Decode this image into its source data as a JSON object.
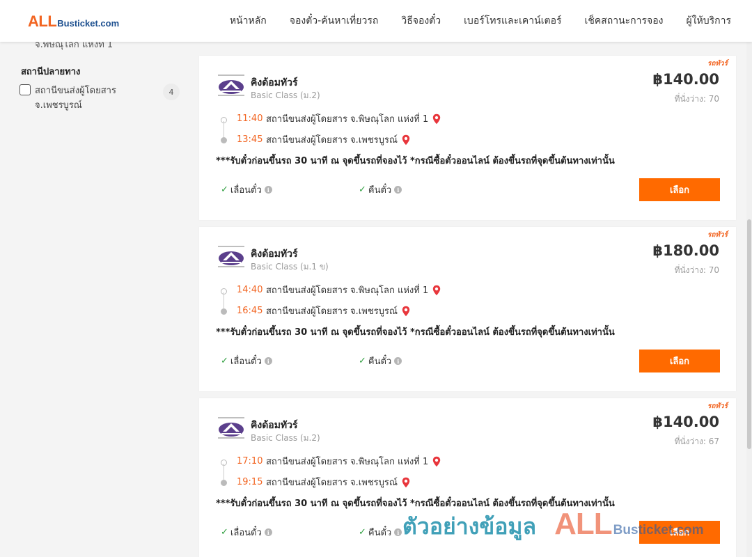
{
  "header": {
    "logo_all": "ALL",
    "logo_rest": "Busticket.com",
    "nav": [
      "หน้าหลัก",
      "จองตั๋ว-ค้นหาเที่ยวรถ",
      "วิธีจองตั๋ว",
      "เบอร์โทรและเคาน์เตอร์",
      "เช็คสถานะการจอง",
      "ผู้ให้บริการ"
    ]
  },
  "sidebar": {
    "prev_item": "จ.พิษณุโลก แห่งที่ 1",
    "dest_title": "สถานีปลายทาง",
    "dest_filter": {
      "label": "สถานีขนส่งผู้โดยสาร จ.เพชรบูรณ์",
      "count": "4",
      "checked": false
    }
  },
  "trips": [
    {
      "tag": "รถทัวร์",
      "operator": "คิงด้อมทัวร์",
      "class": "Basic Class (ม.2)",
      "price": "฿140.00",
      "seats": "ที่นั่งว่าง: 70",
      "depart_time": "11:40",
      "depart_station": "สถานีขนส่งผู้โดยสาร จ.พิษณุโลก แห่งที่ 1",
      "arrive_time": "13:45",
      "arrive_station": "สถานีขนส่งผู้โดยสาร จ.เพชรบูรณ์",
      "note": "***รับตั๋วก่อนขึ้นรถ 30 นาที ณ จุดขึ้นรถที่จองไว้ *กรณีซื้อตั๋วออนไลน์ ต้องขึ้นรถที่จุดขึ้นต้นทางเท่านั้น",
      "feature1": "เลื่อนตั๋ว",
      "feature2": "คืนตั๋ว",
      "button": "เลือก"
    },
    {
      "tag": "รถทัวร์",
      "operator": "คิงด้อมทัวร์",
      "class": "Basic Class (ม.1 ข)",
      "price": "฿180.00",
      "seats": "ที่นั่งว่าง: 70",
      "depart_time": "14:40",
      "depart_station": "สถานีขนส่งผู้โดยสาร จ.พิษณุโลก แห่งที่ 1",
      "arrive_time": "16:45",
      "arrive_station": "สถานีขนส่งผู้โดยสาร จ.เพชรบูรณ์",
      "note": "***รับตั๋วก่อนขึ้นรถ 30 นาที ณ จุดขึ้นรถที่จองไว้ *กรณีซื้อตั๋วออนไลน์ ต้องขึ้นรถที่จุดขึ้นต้นทางเท่านั้น",
      "feature1": "เลื่อนตั๋ว",
      "feature2": "คืนตั๋ว",
      "button": "เลือก"
    },
    {
      "tag": "รถทัวร์",
      "operator": "คิงด้อมทัวร์",
      "class": "Basic Class (ม.2)",
      "price": "฿140.00",
      "seats": "ที่นั่งว่าง: 67",
      "depart_time": "17:10",
      "depart_station": "สถานีขนส่งผู้โดยสาร จ.พิษณุโลก แห่งที่ 1",
      "arrive_time": "19:15",
      "arrive_station": "สถานีขนส่งผู้โดยสาร จ.เพชรบูรณ์",
      "note": "***รับตั๋วก่อนขึ้นรถ 30 นาที ณ จุดขึ้นรถที่จองไว้ *กรณีซื้อตั๋วออนไลน์ ต้องขึ้นรถที่จุดขึ้นต้นทางเท่านั้น",
      "feature1": "เลื่อนตั๋ว",
      "feature2": "คืนตั๋ว",
      "button": "เลือก"
    }
  ],
  "watermark": {
    "thai": "ตัวอย่างข้อมูล",
    "all": "ALL",
    "rest": "Busticket.com"
  },
  "colors": {
    "accent": "#ff6a00",
    "time": "#f26522",
    "pin": "#e8363c",
    "check": "#2e9e3e"
  }
}
